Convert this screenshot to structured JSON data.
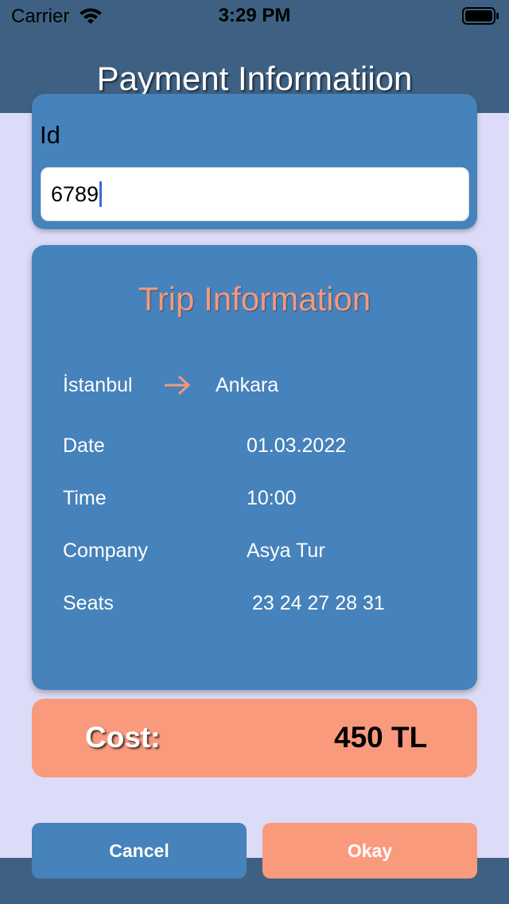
{
  "status_bar": {
    "carrier": "Carrier",
    "time": "3:29 PM",
    "wifi_icon": "wifi-icon",
    "battery_icon": "battery-full-icon"
  },
  "header": {
    "title": "Payment Informatiion"
  },
  "id_section": {
    "label": "Id",
    "value": "6789"
  },
  "trip": {
    "title": "Trip Information",
    "from": "İstanbul",
    "to": "Ankara",
    "route_icon": "arrow-right-icon",
    "rows": [
      {
        "label": "Date",
        "value": "01.03.2022"
      },
      {
        "label": "Time",
        "value": "10:00"
      },
      {
        "label": "Company",
        "value": "Asya Tur"
      },
      {
        "label": "Seats",
        "value": "23 24 27 28 31"
      }
    ]
  },
  "cost": {
    "label": "Cost:",
    "value": "450 TL"
  },
  "buttons": {
    "cancel": "Cancel",
    "okay": "Okay"
  },
  "colors": {
    "header": "#3e6183",
    "card": "#4682bb",
    "accent": "#fa9a7d",
    "background": "#dcdcf8"
  }
}
